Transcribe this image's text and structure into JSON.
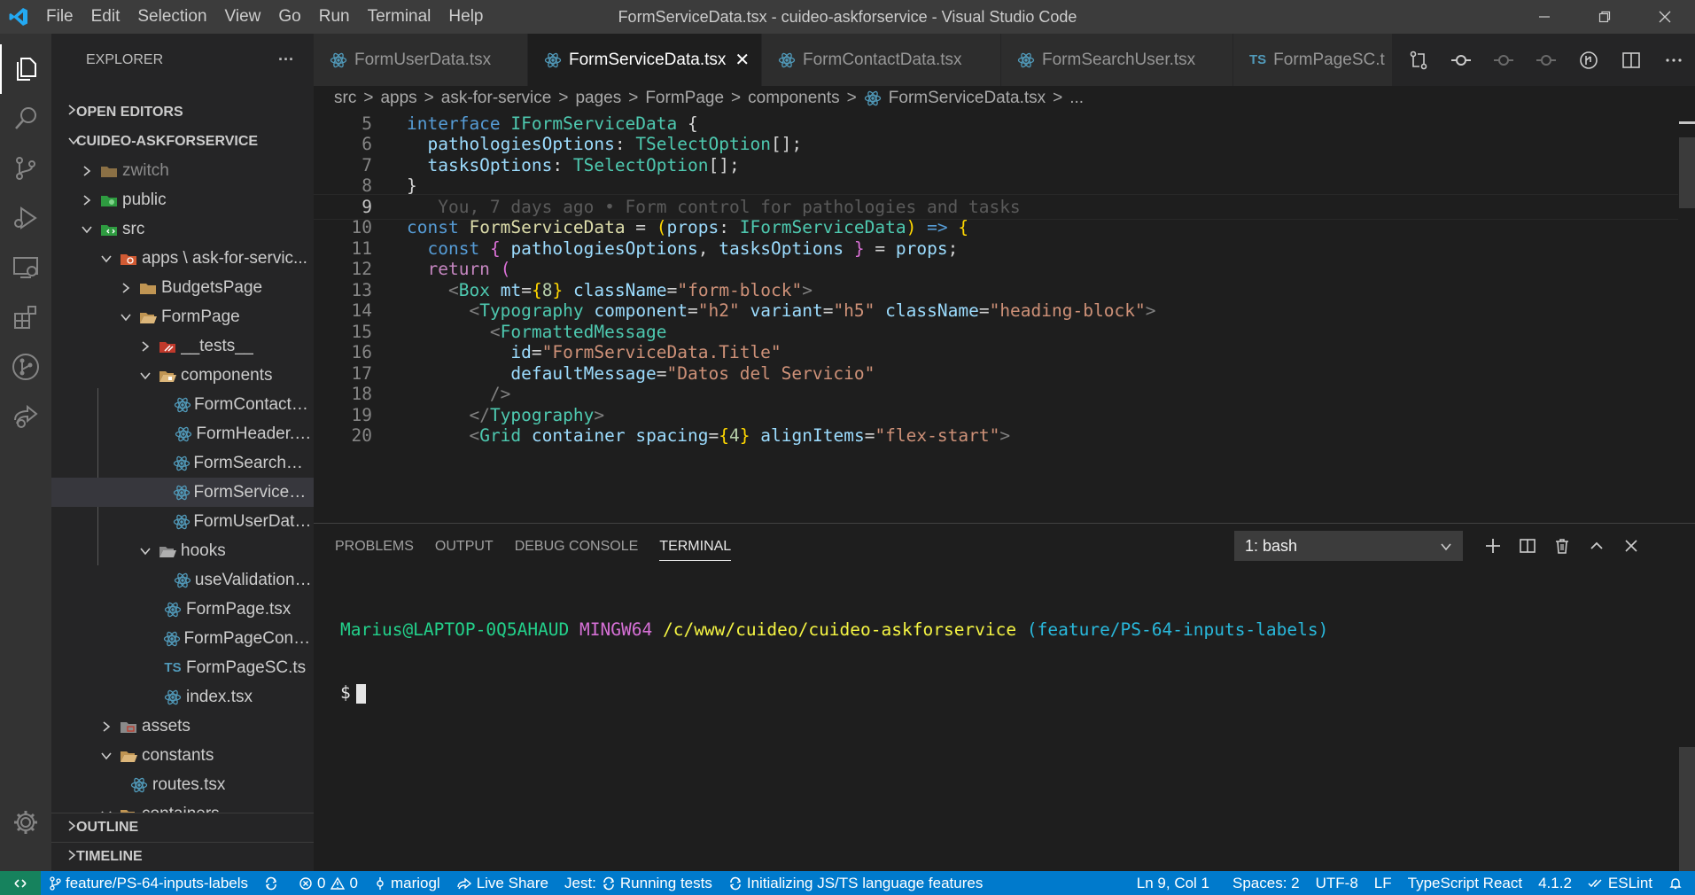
{
  "titlebar": {
    "menu": [
      "File",
      "Edit",
      "Selection",
      "View",
      "Go",
      "Run",
      "Terminal",
      "Help"
    ],
    "title": "FormServiceData.tsx - cuideo-askforservice - Visual Studio Code"
  },
  "sidebar": {
    "header": "EXPLORER",
    "more": "···",
    "open_editors": "OPEN EDITORS",
    "project": "CUIDEO-ASKFORSERVICE",
    "outline": "OUTLINE",
    "timeline": "TIMELINE",
    "tree": [
      {
        "label": "zwitch"
      },
      {
        "label": "public"
      },
      {
        "label": "src"
      },
      {
        "label": "apps \\ ask-for-servic..."
      },
      {
        "label": "BudgetsPage"
      },
      {
        "label": "FormPage"
      },
      {
        "label": "__tests__"
      },
      {
        "label": "components"
      },
      {
        "label": "FormContactDa..."
      },
      {
        "label": "FormHeader.tsx"
      },
      {
        "label": "FormSearchUse..."
      },
      {
        "label": "FormServiceDat..."
      },
      {
        "label": "FormUserData.tsx"
      },
      {
        "label": "hooks"
      },
      {
        "label": "useValidationM..."
      },
      {
        "label": "FormPage.tsx"
      },
      {
        "label": "FormPageContai..."
      },
      {
        "label": "FormPageSC.ts"
      },
      {
        "label": "index.tsx"
      },
      {
        "label": "assets"
      },
      {
        "label": "constants"
      },
      {
        "label": "routes.tsx"
      },
      {
        "label": "containers"
      }
    ]
  },
  "tabs": [
    {
      "label": "FormUserData.tsx"
    },
    {
      "label": "FormServiceData.tsx"
    },
    {
      "label": "FormContactData.tsx"
    },
    {
      "label": "FormSearchUser.tsx"
    },
    {
      "label": "FormPageSC.t"
    }
  ],
  "ts_badge": "TS",
  "close_glyph": "✕",
  "breadcrumb": {
    "items": [
      "src",
      "apps",
      "ask-for-service",
      "pages",
      "FormPage",
      "components",
      "FormServiceData.tsx",
      "..."
    ],
    "sep": ">"
  },
  "editor": {
    "line_numbers": [
      "5",
      "6",
      "7",
      "8",
      "9",
      "10",
      "11",
      "12",
      "13",
      "14",
      "15",
      "16",
      "17",
      "18",
      "19",
      "20"
    ],
    "blame": "You, 7 days ago • Form control for pathologies and tasks",
    "strings": {
      "interface": "interface",
      "IFormServiceData": "IFormServiceData",
      "lbrace": "{",
      "pathologiesOptions": "pathologiesOptions",
      "colon": ":",
      "TSelectOption": "TSelectOption",
      "arr": "[]",
      "semi": ";",
      "tasksOptions": "tasksOptions",
      "rbrace": "}",
      "const": "const",
      "FormServiceData": "FormServiceData",
      "eq": " = ",
      "lparen": "(",
      "props": "props",
      "rparen": ")",
      "arrow": " => ",
      "comma": ", ",
      "return": "return",
      "lt": "<",
      "gt": ">",
      "lt_slash": "</",
      "slash_gt": "/>",
      "Box": "Box",
      "mt": "mt",
      "eqattr": "=",
      "num8": "8",
      "num4": "4",
      "className": "className",
      "form_block": "\"form-block\"",
      "Typography": "Typography",
      "component": "component",
      "h2": "\"h2\"",
      "variant": "variant",
      "h5": "\"h5\"",
      "heading_block": "\"heading-block\"",
      "FormattedMessage": "FormattedMessage",
      "id": "id",
      "id_val": "\"FormServiceData.Title\"",
      "defaultMessage": "defaultMessage",
      "dm_val": "\"Datos del Servicio\"",
      "Grid": "Grid",
      "container": "container",
      "spacing": "spacing",
      "alignItems": "alignItems",
      "flex_start": "\"flex-start\""
    }
  },
  "panel": {
    "tabs": [
      "PROBLEMS",
      "OUTPUT",
      "DEBUG CONSOLE",
      "TERMINAL"
    ],
    "terminal_select": "1: bash",
    "terminal": {
      "user": "Marius@LAPTOP-0Q5AHAUD",
      "host": "MINGW64",
      "path": "/c/www/cuideo/cuideo-askforservice",
      "branch": "(feature/PS-64-inputs-labels)",
      "prompt": "$"
    }
  },
  "statusbar": {
    "branch": "feature/PS-64-inputs-labels",
    "errors": "0",
    "warnings": "0",
    "user": "mariogl",
    "live_share": "Live Share",
    "jest": "Jest:",
    "jest_status": "Running tests",
    "init": "Initializing JS/TS language features",
    "position": "Ln 9, Col 1",
    "spaces": "Spaces: 2",
    "encoding": "UTF-8",
    "eol": "LF",
    "language": "TypeScript React",
    "version": "4.1.2",
    "eslint": "ESLint"
  },
  "colors": {
    "accent": "#007acc",
    "remote": "#16825d",
    "react_icon": "#519aba",
    "folder": "#c09553"
  }
}
